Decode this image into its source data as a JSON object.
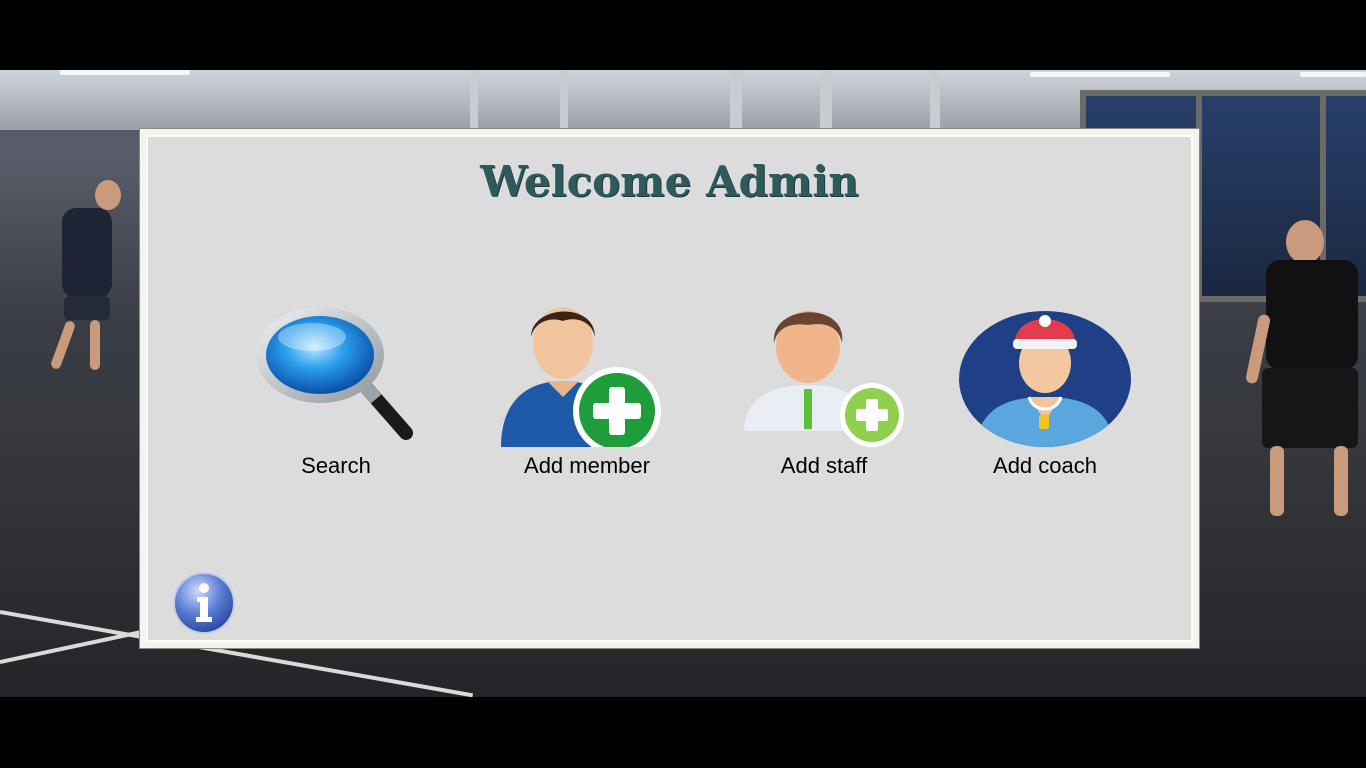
{
  "window": {
    "title": "Welcome Admin"
  },
  "actions": [
    {
      "id": "search",
      "label": "Search",
      "icon": "search-icon"
    },
    {
      "id": "add-member",
      "label": "Add member",
      "icon": "add-member-icon"
    },
    {
      "id": "add-staff",
      "label": "Add staff",
      "icon": "add-staff-icon"
    },
    {
      "id": "add-coach",
      "label": "Add coach",
      "icon": "add-coach-icon"
    }
  ],
  "info": {
    "icon": "info-icon"
  },
  "colors": {
    "title": "#2e5a5c",
    "panel": "#dcdcdc",
    "border": "#f4f3ee",
    "plus_green": "#1e9d3a",
    "plus_light_green": "#8fd14f",
    "info_blue": "#5b7fd6"
  }
}
